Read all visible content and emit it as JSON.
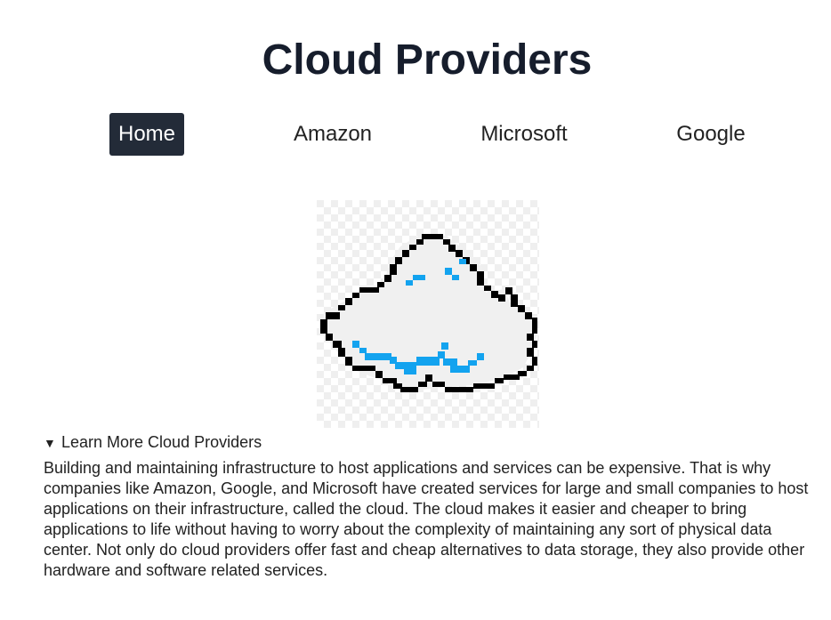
{
  "header": {
    "title": "Cloud Providers"
  },
  "nav": {
    "items": [
      {
        "label": "Home",
        "active": true
      },
      {
        "label": "Amazon",
        "active": false
      },
      {
        "label": "Microsoft",
        "active": false
      },
      {
        "label": "Google",
        "active": false
      }
    ]
  },
  "hero": {
    "icon": "pixel-cloud-icon",
    "colors": {
      "outline": "#000000",
      "fill": "#f0f0f0",
      "accent": "#13a3ef"
    }
  },
  "details": {
    "summary": "Learn More Cloud Providers",
    "toggle_glyph": "▼",
    "text": "Building and maintaining infrastructure to host applications and services can be expensive. That is why companies like Amazon, Google, and Microsoft have created services for large and small companies to host applications on their infrastructure, called the cloud. The cloud makes it easier and cheaper to bring applications to life without having to worry about the complexity of maintaining any sort of physical data center. Not only do cloud providers offer fast and cheap alternatives to data storage, they also provide other hardware and software related services."
  },
  "colors": {
    "title": "#161d2c",
    "nav_active_bg": "#232b38",
    "nav_active_text": "#ffffff"
  }
}
